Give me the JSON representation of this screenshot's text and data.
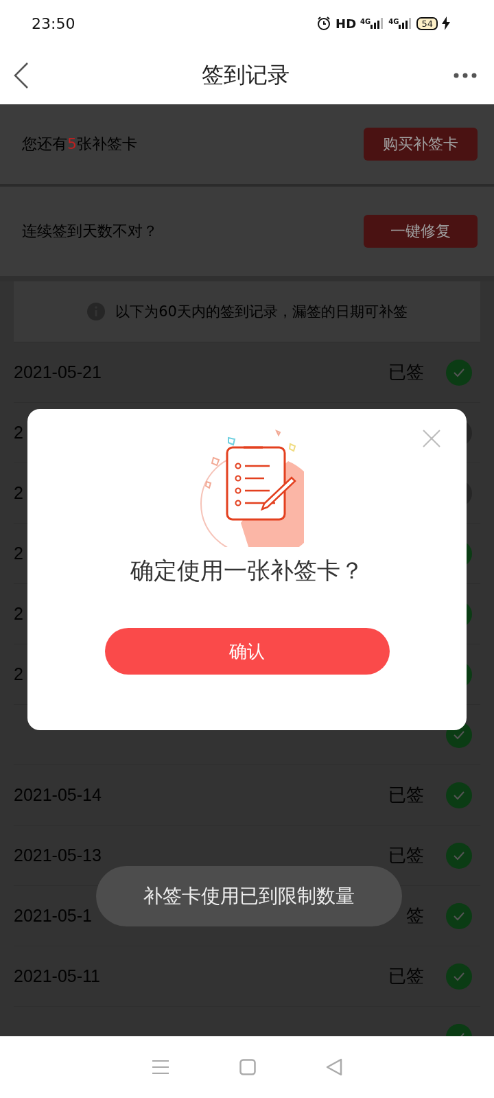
{
  "status_bar": {
    "time": "23:50",
    "hd_label": "HD",
    "signal_labels": [
      "4G",
      "4G"
    ],
    "battery": "54"
  },
  "header": {
    "title": "签到记录"
  },
  "cards_section": {
    "prefix": "您还有",
    "count": "5",
    "suffix": "张补签卡",
    "button": "购买补签卡"
  },
  "repair_section": {
    "prompt": "连续签到天数不对？",
    "button": "一键修复"
  },
  "notice": "以下为60天内的签到记录，漏签的日期可补签",
  "records": [
    {
      "date": "2021-05-21",
      "status": "已签",
      "signed": true
    },
    {
      "date": "2",
      "signed": false
    },
    {
      "date": "2",
      "signed": false
    },
    {
      "date": "2",
      "signed": true
    },
    {
      "date": "2",
      "signed": true
    },
    {
      "date": "2",
      "signed": true
    },
    {
      "signed": true
    },
    {
      "date": "2021-05-14",
      "status": "已签",
      "signed": true
    },
    {
      "date": "2021-05-13",
      "status": "已签",
      "signed": true
    },
    {
      "date": "2021-05-1",
      "status": "签",
      "signed": true
    },
    {
      "date": "2021-05-11",
      "status": "已签",
      "signed": true
    },
    {
      "signed": true
    }
  ],
  "dialog": {
    "title": "确定使用一张补签卡？",
    "confirm_button": "确认"
  },
  "toast": "补签卡使用已到限制数量"
}
